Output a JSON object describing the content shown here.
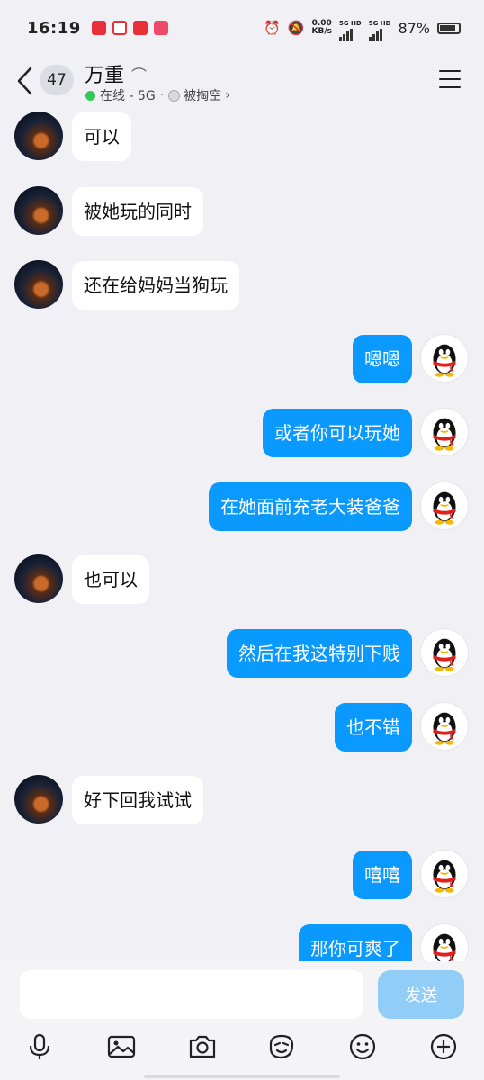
{
  "status_bar": {
    "time": "16:19",
    "net_speed_value": "0.00",
    "net_speed_unit": "KB/s",
    "sim1_label": "5G HD",
    "sim2_label": "5G HD",
    "battery": "87%"
  },
  "header": {
    "unread_count": "47",
    "contact_name": "万重",
    "status": "在线 - 5G",
    "activity": "被掏空"
  },
  "messages": [
    {
      "side": "in",
      "text": "可以"
    },
    {
      "side": "in",
      "text": "被她玩的同时"
    },
    {
      "side": "in",
      "text": "还在给妈妈当狗玩"
    },
    {
      "side": "out",
      "text": "嗯嗯"
    },
    {
      "side": "out",
      "text": "或者你可以玩她"
    },
    {
      "side": "out",
      "text": "在她面前充老大装爸爸"
    },
    {
      "side": "in",
      "text": "也可以"
    },
    {
      "side": "out",
      "text": "然后在我这特别下贱"
    },
    {
      "side": "out",
      "text": "也不错"
    },
    {
      "side": "in",
      "text": "好下回我试试"
    },
    {
      "side": "out",
      "text": "嘻嘻"
    },
    {
      "side": "out",
      "text": "那你可爽了"
    }
  ],
  "composer": {
    "value": "",
    "send_label": "发送"
  },
  "toolbar": [
    {
      "name": "microphone-icon"
    },
    {
      "name": "image-icon"
    },
    {
      "name": "camera-icon"
    },
    {
      "name": "sticker-icon"
    },
    {
      "name": "emoji-icon"
    },
    {
      "name": "plus-icon"
    }
  ],
  "colors": {
    "background": "#f0f0f5",
    "outgoing_bubble": "#0a99ff",
    "incoming_bubble": "#ffffff",
    "send_button": "#92cdf8",
    "online": "#34c759"
  }
}
